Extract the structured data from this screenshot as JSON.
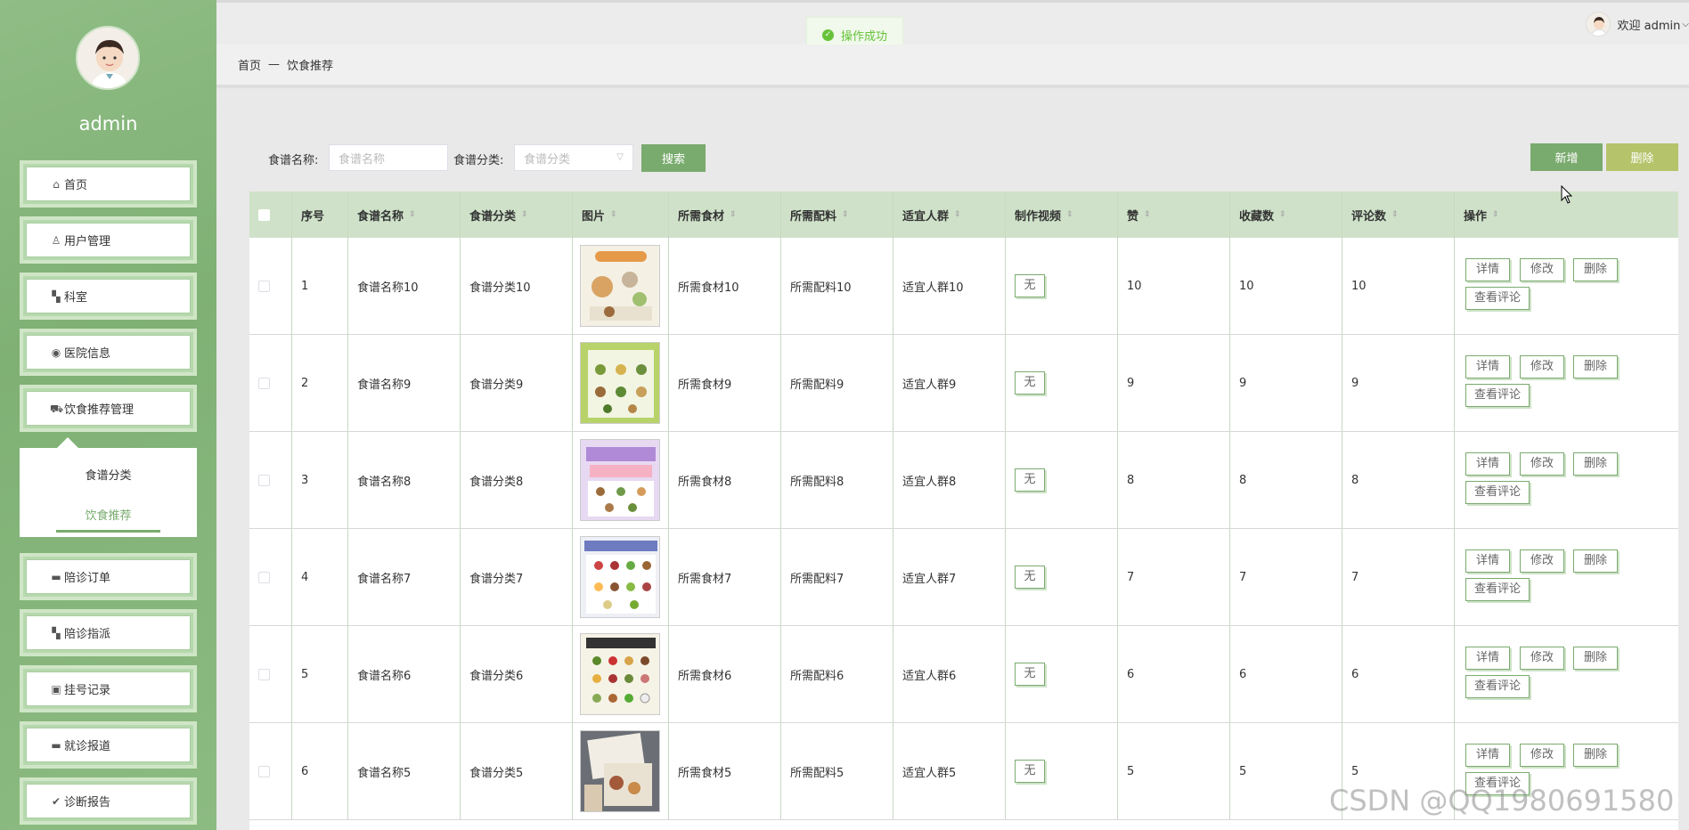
{
  "sidebar": {
    "username": "admin",
    "items": [
      {
        "label": "首页",
        "icon": "home-icon"
      },
      {
        "label": "用户管理",
        "icon": "user-icon"
      },
      {
        "label": "科室",
        "icon": "grid-icon"
      },
      {
        "label": "医院信息",
        "icon": "circle-icon"
      },
      {
        "label": "饮食推荐管理",
        "icon": "car-icon"
      },
      {
        "label": "陪诊订单",
        "icon": "card-icon"
      },
      {
        "label": "陪诊指派",
        "icon": "grid-icon"
      },
      {
        "label": "挂号记录",
        "icon": "briefcase-icon"
      },
      {
        "label": "就诊报道",
        "icon": "card-icon"
      },
      {
        "label": "诊断报告",
        "icon": "check-circle-icon"
      }
    ],
    "submenu": [
      {
        "label": "食谱分类"
      },
      {
        "label": "饮食推荐"
      }
    ]
  },
  "topbar": {
    "toast": "操作成功",
    "welcome": "欢迎 admin"
  },
  "breadcrumb": {
    "home": "首页",
    "sep": "—",
    "current": "饮食推荐"
  },
  "search": {
    "name_label": "食谱名称:",
    "name_placeholder": "食谱名称",
    "category_label": "食谱分类:",
    "category_placeholder": "食谱分类",
    "search_button": "搜索",
    "add_button": "新增",
    "delete_button": "删除"
  },
  "table": {
    "headers": [
      "序号",
      "食谱名称",
      "食谱分类",
      "图片",
      "所需食材",
      "所需配料",
      "适宜人群",
      "制作视频",
      "赞",
      "收藏数",
      "评论数",
      "操作"
    ],
    "rows": [
      {
        "index": "1",
        "name": "食谱名称10",
        "category": "食谱分类10",
        "ingredients": "所需食材10",
        "seasoning": "所需配料10",
        "crowd": "适宜人群10",
        "video": "无",
        "likes": "10",
        "favorites": "10",
        "comments": "10"
      },
      {
        "index": "2",
        "name": "食谱名称9",
        "category": "食谱分类9",
        "ingredients": "所需食材9",
        "seasoning": "所需配料9",
        "crowd": "适宜人群9",
        "video": "无",
        "likes": "9",
        "favorites": "9",
        "comments": "9"
      },
      {
        "index": "3",
        "name": "食谱名称8",
        "category": "食谱分类8",
        "ingredients": "所需食材8",
        "seasoning": "所需配料8",
        "crowd": "适宜人群8",
        "video": "无",
        "likes": "8",
        "favorites": "8",
        "comments": "8"
      },
      {
        "index": "4",
        "name": "食谱名称7",
        "category": "食谱分类7",
        "ingredients": "所需食材7",
        "seasoning": "所需配料7",
        "crowd": "适宜人群7",
        "video": "无",
        "likes": "7",
        "favorites": "7",
        "comments": "7"
      },
      {
        "index": "5",
        "name": "食谱名称6",
        "category": "食谱分类6",
        "ingredients": "所需食材6",
        "seasoning": "所需配料6",
        "crowd": "适宜人群6",
        "video": "无",
        "likes": "6",
        "favorites": "6",
        "comments": "6"
      },
      {
        "index": "6",
        "name": "食谱名称5",
        "category": "食谱分类5",
        "ingredients": "所需食材5",
        "seasoning": "所需配料5",
        "crowd": "适宜人群5",
        "video": "无",
        "likes": "5",
        "favorites": "5",
        "comments": "5"
      }
    ],
    "actions": {
      "detail": "详情",
      "edit": "修改",
      "delete": "删除",
      "view_comments": "查看评论"
    }
  },
  "watermark": "CSDN @QQ1980691580",
  "colors": {
    "sidebar_green": "#7fb074",
    "header_green": "#cfe2c9",
    "accent": "#7aab6e",
    "delete_olive": "#b5c36a",
    "toast_green": "#67c23a"
  }
}
